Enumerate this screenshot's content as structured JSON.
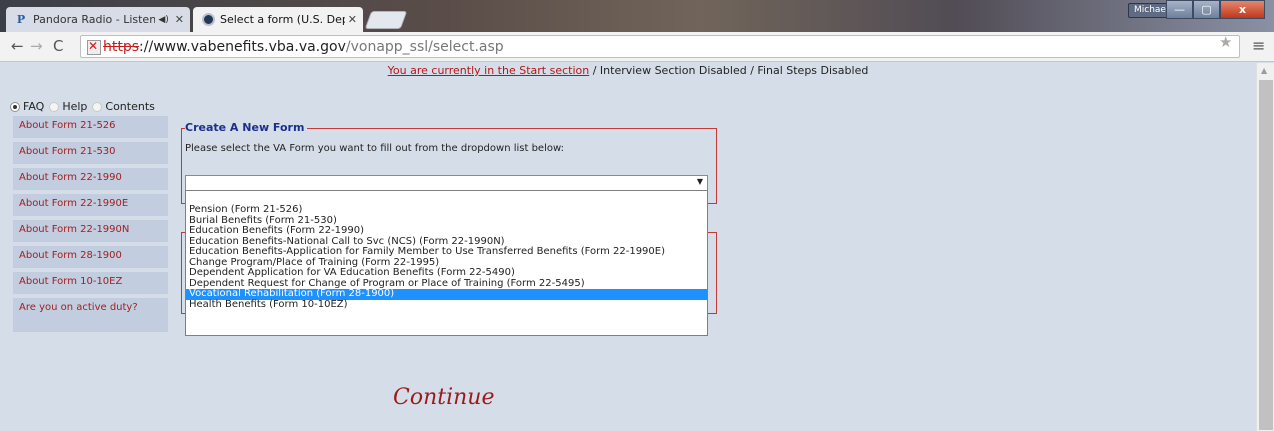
{
  "tabs": [
    {
      "title": "Pandora Radio - Listen",
      "favicon": "P",
      "audio_icon": "speaker-icon"
    },
    {
      "title": "Select a form (U.S. Depart",
      "favicon": "va-seal-icon"
    }
  ],
  "window": {
    "user": "Michael",
    "minimize": "—",
    "maximize": "▢",
    "close": "x"
  },
  "toolbar": {
    "url_scheme": "https",
    "url_host": "://www.vabenefits.vba.va.gov",
    "url_path": "/vonapp_ssl/select.asp"
  },
  "status": {
    "current": "You are currently in the Start section",
    "rest": " / Interview Section Disabled / Final Steps Disabled"
  },
  "faq_tabs": [
    {
      "label": "FAQ",
      "selected": true
    },
    {
      "label": "Help",
      "selected": false
    },
    {
      "label": "Contents",
      "selected": false
    }
  ],
  "sidebar": {
    "items": [
      "About Form 21-526",
      "About Form 21-530",
      "About Form 22-1990",
      "About Form 22-1990E",
      "About Form 22-1990N",
      "About Form 28-1900",
      "About Form 10-10EZ",
      "Are you on active duty?"
    ]
  },
  "form": {
    "legend": "Create A New Form",
    "instruction": "Please select the VA Form you want to fill out from the dropdown list below:",
    "selected_value": "",
    "options": [
      "Pension (Form 21-526)",
      "Burial Benefits (Form 21-530)",
      "Education Benefits (Form 22-1990)",
      "Education Benefits-National Call to Svc (NCS) (Form 22-1990N)",
      "Education Benefits-Application for Family Member to Use Transferred Benefits (Form 22-1990E)",
      "Change Program/Place of Training (Form 22-1995)",
      "Dependent Application for VA Education Benefits (Form 22-5490)",
      "Dependent Request for Change of Program or Place of Training (Form 22-5495)",
      "Vocational Rehabilitation (Form 28-1900)",
      "Health Benefits (Form 10-10EZ)"
    ],
    "highlighted_index": 8
  },
  "continue_label": "Continue",
  "colors": {
    "link": "#a02020",
    "sidebar_bg": "#c2cde0",
    "page_bg": "#d5dee8",
    "highlight": "#1e90ff"
  }
}
